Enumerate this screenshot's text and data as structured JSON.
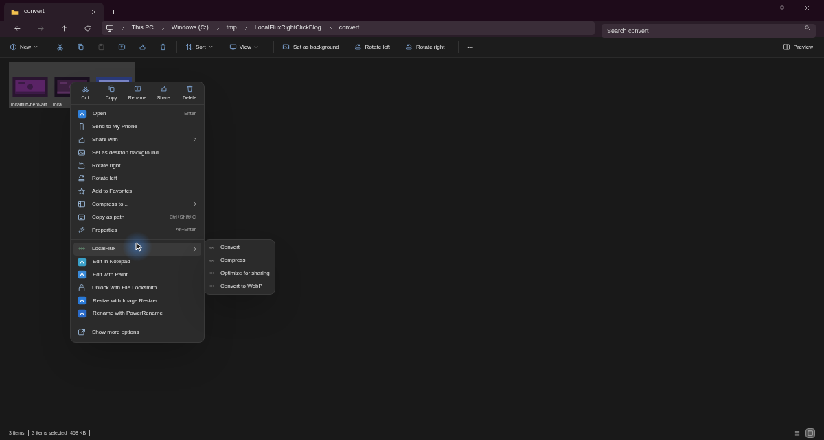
{
  "window": {
    "tabs": [
      {
        "label": "convert",
        "selected": true
      }
    ]
  },
  "address_bar": {
    "breadcrumb": [
      "This PC",
      "Windows (C:)",
      "tmp",
      "LocalFluxRightClickBlog",
      "convert"
    ]
  },
  "search": {
    "placeholder": "Search convert"
  },
  "toolbar": {
    "items": [
      {
        "kind": "menu",
        "label": "New"
      },
      {
        "kind": "icon",
        "disabled": false
      },
      {
        "kind": "icon",
        "disabled": false
      },
      {
        "kind": "icon",
        "disabled": true
      },
      {
        "kind": "icon",
        "disabled": false
      },
      {
        "kind": "icon",
        "disabled": false
      },
      {
        "kind": "icon",
        "disabled": false
      },
      {
        "kind": "divider"
      },
      {
        "kind": "menu",
        "label": "Sort"
      },
      {
        "kind": "menu",
        "label": "View"
      },
      {
        "kind": "divider"
      },
      {
        "kind": "button",
        "label": "Set as background"
      },
      {
        "kind": "button",
        "label": "Rotate left"
      },
      {
        "kind": "button",
        "label": "Rotate right"
      },
      {
        "kind": "divider"
      },
      {
        "kind": "more",
        "label": "•••"
      }
    ],
    "preview": "Preview"
  },
  "files": [
    {
      "label": "localflux-hero-art",
      "selected": true
    },
    {
      "label": "loca",
      "selected": true
    },
    {
      "selected": true
    }
  ],
  "context_menu": {
    "actions": [
      "Cut",
      "Copy",
      "Rename",
      "Share",
      "Delete"
    ],
    "groups": [
      [
        {
          "label": "Open",
          "shortcut": "Enter",
          "submenu": false,
          "highlighted": false
        },
        {
          "label": "Send to My Phone",
          "submenu": false,
          "highlighted": false
        },
        {
          "label": "Share with",
          "submenu": true,
          "highlighted": false
        },
        {
          "label": "Set as desktop background",
          "submenu": false,
          "highlighted": false
        },
        {
          "label": "Rotate right",
          "submenu": false,
          "highlighted": false
        },
        {
          "label": "Rotate left",
          "submenu": false,
          "highlighted": false
        },
        {
          "label": "Add to Favorites",
          "submenu": false,
          "highlighted": false
        },
        {
          "label": "Compress to...",
          "submenu": true,
          "highlighted": false
        },
        {
          "label": "Copy as path",
          "shortcut": "Ctrl+Shift+C",
          "submenu": false,
          "highlighted": false
        },
        {
          "label": "Properties",
          "shortcut": "Alt+Enter",
          "submenu": false,
          "highlighted": false
        }
      ],
      [
        {
          "label": "LocalFlux",
          "submenu": true,
          "highlighted": true
        },
        {
          "label": "Edit in Notepad",
          "submenu": false,
          "highlighted": false
        },
        {
          "label": "Edit with Paint",
          "submenu": false,
          "highlighted": false
        },
        {
          "label": "Unlock with File Locksmith",
          "submenu": false,
          "highlighted": false
        },
        {
          "label": "Resize with Image Resizer",
          "submenu": false,
          "highlighted": false
        },
        {
          "label": "Rename with PowerRename",
          "submenu": false,
          "highlighted": false
        }
      ],
      [
        {
          "label": "Show more options",
          "submenu": false,
          "highlighted": false
        }
      ]
    ]
  },
  "submenu": {
    "items": [
      "Convert",
      "Compress",
      "Optimize for sharing",
      "Convert to WebP"
    ]
  },
  "status_bar": {
    "items": [
      "3 items",
      "3 items selected",
      "458 KB"
    ]
  },
  "view_toggles": [
    {
      "kind": "details",
      "selected": false
    },
    {
      "kind": "tiles",
      "selected": true
    }
  ]
}
